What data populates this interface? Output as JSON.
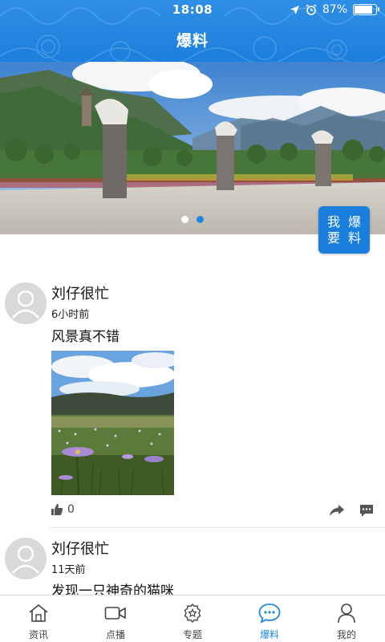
{
  "status_bar": {
    "time": "18:08",
    "battery": "87%",
    "battery_level": 0.87
  },
  "header": {
    "title": "爆料"
  },
  "banner": {
    "slides": 2,
    "active_slide": 1
  },
  "report_button": {
    "label": "我要爆料"
  },
  "posts": [
    {
      "username": "刘仔很忙",
      "time": "6小时前",
      "text": "风景真不错",
      "likes": "0",
      "has_image": true
    },
    {
      "username": "刘仔很忙",
      "time": "11天前",
      "text": "发现一只神奇的猫咪",
      "has_image": false
    }
  ],
  "tabbar": {
    "active": "爆料",
    "colors": {
      "active": "#1e86e0",
      "inactive": "#444444"
    },
    "items": [
      {
        "label": "资讯",
        "icon": "home-icon"
      },
      {
        "label": "点播",
        "icon": "video-icon"
      },
      {
        "label": "专题",
        "icon": "badge-icon"
      },
      {
        "label": "爆料",
        "icon": "chat-bubble-icon"
      },
      {
        "label": "我的",
        "icon": "person-icon"
      }
    ]
  },
  "colors": {
    "brand": "#1e86e0",
    "header": "#2f8ee6"
  }
}
